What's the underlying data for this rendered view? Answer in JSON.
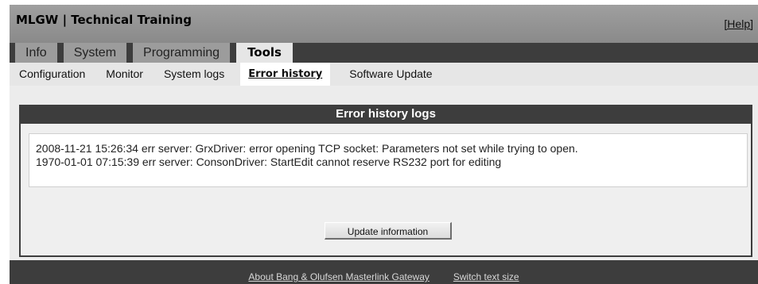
{
  "header": {
    "title": "MLGW | Technical Training",
    "help_label": "[Help]"
  },
  "tabs": [
    {
      "label": "Info"
    },
    {
      "label": "System"
    },
    {
      "label": "Programming"
    },
    {
      "label": "Tools",
      "active": true
    }
  ],
  "subnav": [
    {
      "label": "Configuration"
    },
    {
      "label": "Monitor"
    },
    {
      "label": "System logs"
    },
    {
      "label": "Error history",
      "active": true
    },
    {
      "label": "Software Update"
    }
  ],
  "panel": {
    "title": "Error history logs",
    "logs": [
      "2008-11-21 15:26:34 err server: GrxDriver: error opening TCP socket: Parameters not set while trying to open.",
      "1970-01-01 07:15:39 err server: ConsonDriver: StartEdit cannot reserve RS232 port for editing"
    ],
    "button_label": "Update information"
  },
  "footer": {
    "about_label": "About Bang & Olufsen Masterlink Gateway",
    "text_size_label": "Switch text size"
  }
}
